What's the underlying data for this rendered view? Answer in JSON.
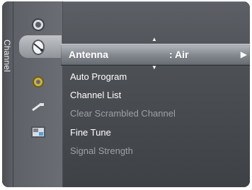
{
  "sidebar_tab": "Channel",
  "selected": {
    "label": "Antenna",
    "value": ": Air",
    "arrow": "▶",
    "scroll_up": "▲",
    "scroll_down": "▼"
  },
  "menu_items": [
    {
      "label": "Auto Program",
      "enabled": true
    },
    {
      "label": "Channel List",
      "enabled": true
    },
    {
      "label": "Clear Scrambled Channel",
      "enabled": false
    },
    {
      "label": "Fine Tune",
      "enabled": true
    },
    {
      "label": "Signal Strength",
      "enabled": false
    }
  ],
  "icons": [
    "picture-icon",
    "channel-dish-icon",
    "setup-gear-icon",
    "input-plug-icon",
    "application-icon"
  ]
}
